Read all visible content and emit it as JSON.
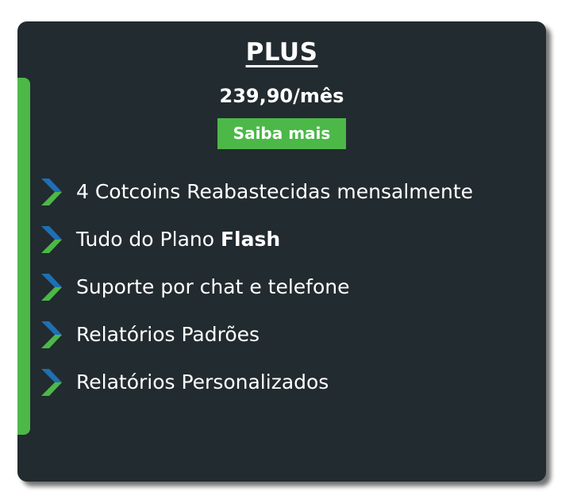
{
  "card": {
    "plan_name": "PLUS",
    "price": "239,90/mês",
    "cta_label": "Saiba mais"
  },
  "features": [
    {
      "text": "4 Cotcoins Reabastecidas mensalmente",
      "bold": ""
    },
    {
      "text": "Tudo do Plano ",
      "bold": "Flash"
    },
    {
      "text": "Suporte por chat e telefone",
      "bold": ""
    },
    {
      "text": "Relatórios Padrões",
      "bold": ""
    },
    {
      "text": "Relatórios Personalizados",
      "bold": ""
    }
  ],
  "colors": {
    "card_bg": "#222b2f",
    "accent_green": "#4cb848",
    "chevron_blue": "#1f6fb4",
    "text": "#ffffff"
  },
  "icons": {
    "feature_bullet": "chevron-right-icon"
  }
}
